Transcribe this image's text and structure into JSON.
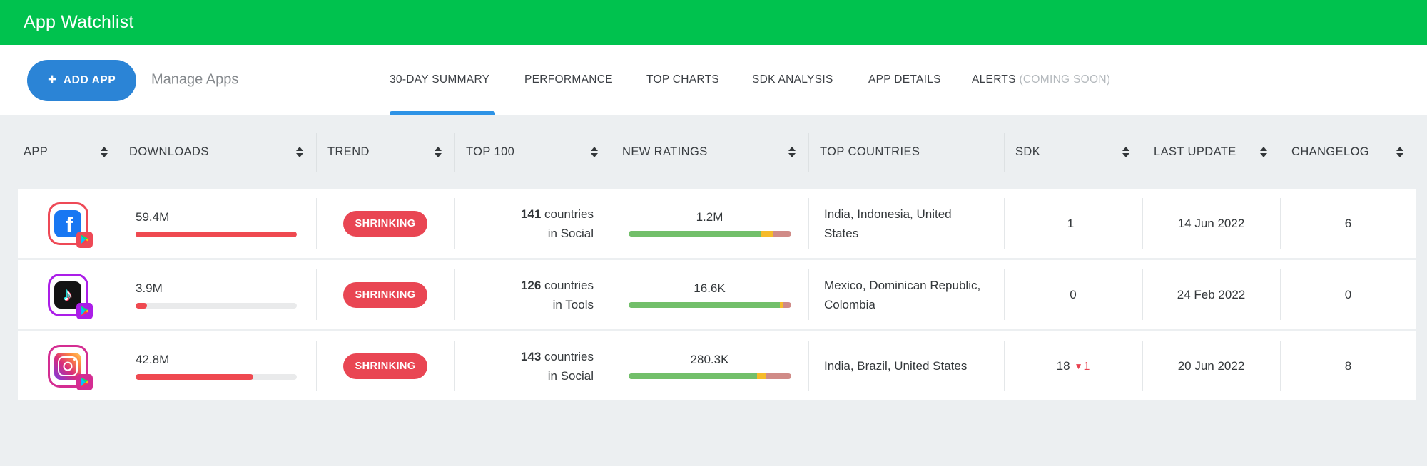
{
  "header": {
    "title": "App Watchlist"
  },
  "toolbar": {
    "add_app": {
      "plus_icon": "+",
      "label": "ADD APP"
    },
    "manage_apps_label": "Manage Apps",
    "tabs": [
      {
        "label": "30-DAY SUMMARY",
        "active": true
      },
      {
        "label": "PERFORMANCE"
      },
      {
        "label": "TOP CHARTS"
      },
      {
        "label": "SDK ANALYSIS"
      },
      {
        "label": "APP DETAILS"
      },
      {
        "label": "ALERTS",
        "suffix": "(COMING SOON)"
      }
    ]
  },
  "table": {
    "columns": [
      {
        "label": "APP",
        "sortable": true
      },
      {
        "label": "DOWNLOADS",
        "sortable": true
      },
      {
        "label": "TREND",
        "sortable": true
      },
      {
        "label": "TOP 100",
        "sortable": true
      },
      {
        "label": "NEW RATINGS",
        "sortable": true
      },
      {
        "label": "TOP COUNTRIES",
        "sortable": false
      },
      {
        "label": "SDK",
        "sortable": true
      },
      {
        "label": "LAST UPDATE",
        "sortable": true
      },
      {
        "label": "CHANGELOG",
        "sortable": true
      }
    ]
  },
  "apps": [
    {
      "name": "Facebook",
      "icon": "facebook-app-icon",
      "icon_glyph": "f",
      "accent": "#ee4956",
      "downloads": {
        "value": "59.4M",
        "bar_width": "100%"
      },
      "trend": "SHRINKING",
      "top100": {
        "count": "141",
        "unit": "countries",
        "category": "in Social"
      },
      "new_ratings": {
        "value": "1.2M",
        "bar": {
          "positive": "82%",
          "neutral": "7%",
          "negative": "11%"
        }
      },
      "top_countries": "India, Indonesia, United States",
      "sdk": {
        "value": "1",
        "change": "",
        "change_icon": ""
      },
      "last_update": "14 Jun 2022",
      "changelog": "6"
    },
    {
      "name": "TikTok",
      "icon": "tiktok-app-icon",
      "icon_glyph": "♪",
      "accent": "#ab1ee8",
      "downloads": {
        "value": "3.9M",
        "bar_width": "7%"
      },
      "trend": "SHRINKING",
      "top100": {
        "count": "126",
        "unit": "countries",
        "category": "in Tools"
      },
      "new_ratings": {
        "value": "16.6K",
        "bar": {
          "positive": "93%",
          "neutral": "2%",
          "negative": "5%"
        }
      },
      "top_countries": "Mexico, Dominican Republic, Colombia",
      "sdk": {
        "value": "0",
        "change": "",
        "change_icon": ""
      },
      "last_update": "24 Feb 2022",
      "changelog": "0"
    },
    {
      "name": "Instagram",
      "icon": "instagram-app-icon",
      "icon_glyph": "",
      "accent": "#d42d92",
      "downloads": {
        "value": "42.8M",
        "bar_width": "73%"
      },
      "trend": "SHRINKING",
      "top100": {
        "count": "143",
        "unit": "countries",
        "category": "in Social"
      },
      "new_ratings": {
        "value": "280.3K",
        "bar": {
          "positive": "79%",
          "neutral": "6%",
          "negative": "15%"
        }
      },
      "top_countries": "India, Brazil, United States",
      "sdk": {
        "value": "18",
        "change": "1",
        "change_icon": "▼"
      },
      "last_update": "20 Jun 2022",
      "changelog": "8"
    }
  ],
  "colors": {
    "brand_green": "#00c24e",
    "button_blue": "#2b84d6",
    "tab_underline_blue": "#2e93e6",
    "trend_red": "#e94653",
    "downloads_bar_red": "#ef4950",
    "ratings_positive_green": "#72bf6a",
    "ratings_neutral_yellow": "#f6bb29",
    "ratings_negative_red": "#d08b87",
    "page_background": "#eceff1"
  }
}
